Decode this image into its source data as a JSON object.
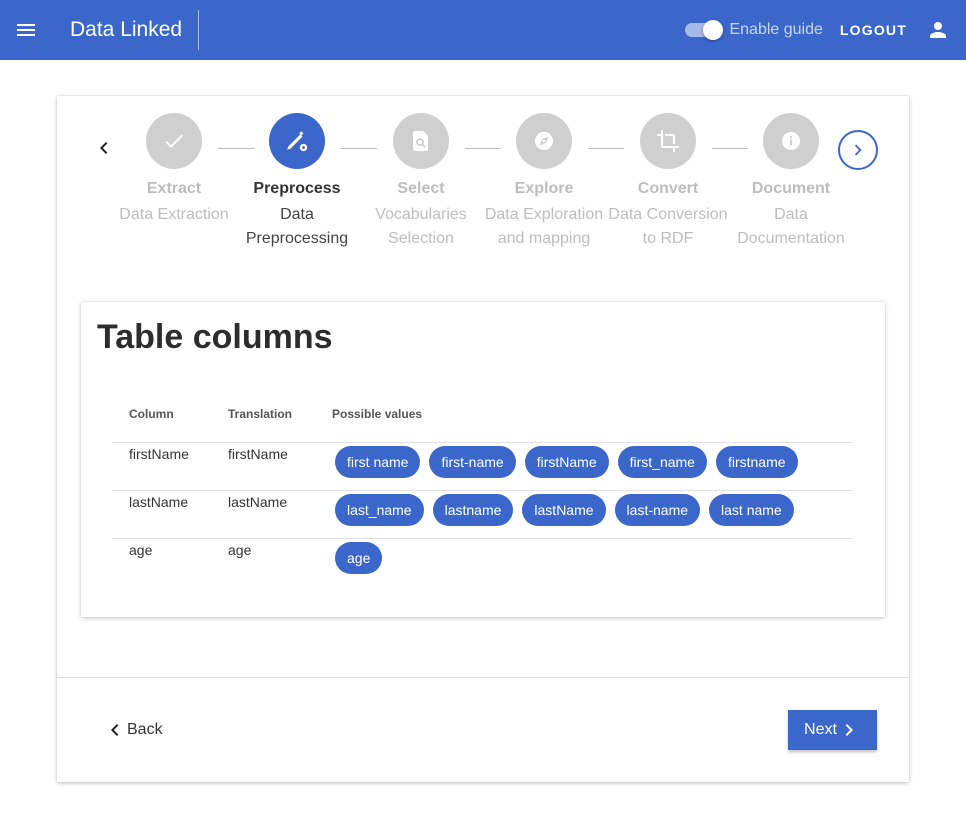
{
  "appbar": {
    "title": "Data Linked",
    "guide_label": "Enable guide",
    "guide_enabled": true,
    "logout_label": "LOGOUT",
    "menu_icon": "menu-icon",
    "user_icon": "account-icon"
  },
  "stepper": {
    "steps": [
      {
        "title": "Extract",
        "subtitle": "Data Extraction",
        "icon": "check-icon",
        "state": "completed"
      },
      {
        "title": "Preprocess",
        "subtitle": "Data Preprocessing",
        "icon": "edit-settings-icon",
        "state": "active"
      },
      {
        "title": "Select",
        "subtitle": "Vocabularies Selection",
        "icon": "find-in-page-icon",
        "state": "inactive"
      },
      {
        "title": "Explore",
        "subtitle": "Data Exploration and mapping",
        "icon": "compass-icon",
        "state": "inactive"
      },
      {
        "title": "Convert",
        "subtitle": "Data Conversion to RDF",
        "icon": "crop-icon",
        "state": "inactive"
      },
      {
        "title": "Document",
        "subtitle": "Data Documentation",
        "icon": "info-icon",
        "state": "inactive"
      }
    ]
  },
  "table_card": {
    "title": "Table columns",
    "headers": [
      "Column",
      "Translation",
      "Possible values"
    ],
    "rows": [
      {
        "column": "firstName",
        "translation": "firstName",
        "values": [
          "first name",
          "first-name",
          "firstName",
          "first_name",
          "firstname"
        ]
      },
      {
        "column": "lastName",
        "translation": "lastName",
        "values": [
          "last_name",
          "lastname",
          "lastName",
          "last-name",
          "last name"
        ]
      },
      {
        "column": "age",
        "translation": "age",
        "values": [
          "age"
        ]
      }
    ]
  },
  "footer": {
    "back_label": "Back",
    "next_label": "Next"
  },
  "colors": {
    "primary": "#3b67cb",
    "inactive_step": "#cfcfcf"
  }
}
